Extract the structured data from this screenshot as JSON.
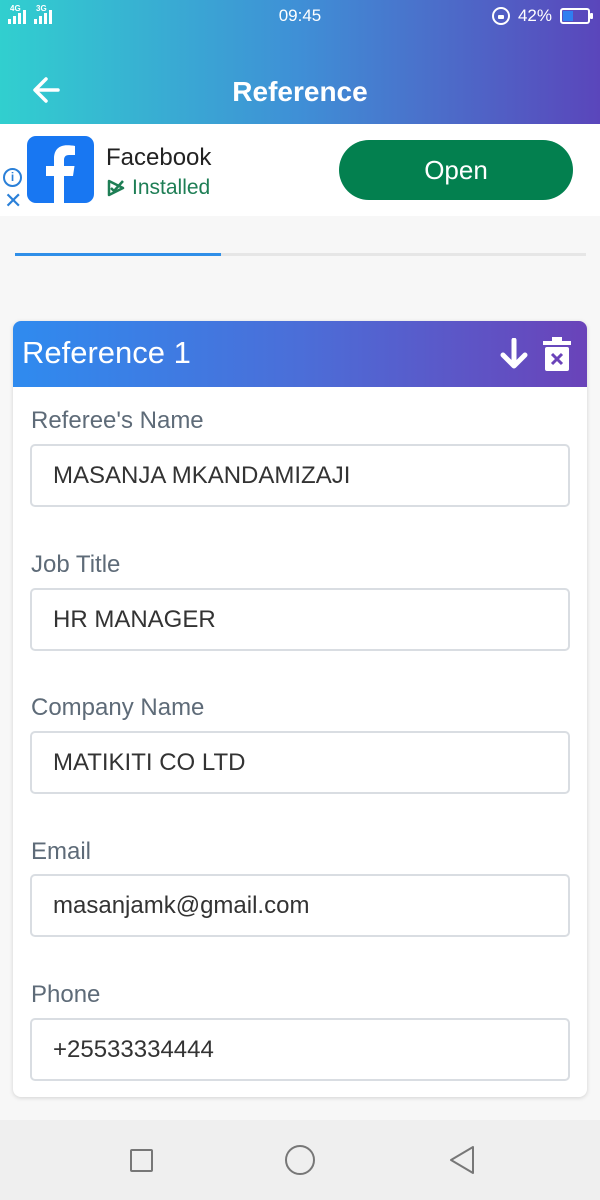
{
  "status_bar": {
    "net1": "4G",
    "net2": "3G",
    "time": "09:45",
    "battery": "42%",
    "battery_level": 0.42
  },
  "app_bar": {
    "title": "Reference"
  },
  "ad": {
    "app_name": "Facebook",
    "status": "Installed",
    "button_label": "Open"
  },
  "progress": {
    "fraction": 0.36
  },
  "reference": {
    "title": "Reference 1",
    "fields": [
      {
        "label": "Referee's Name",
        "value": "MASANJA MKANDAMIZAJI"
      },
      {
        "label": "Job Title",
        "value": "HR MANAGER"
      },
      {
        "label": "Company Name",
        "value": "MATIKITI CO LTD"
      },
      {
        "label": "Email",
        "value": "masanjamk@gmail.com"
      },
      {
        "label": "Phone",
        "value": "+25533334444"
      }
    ]
  },
  "colors": {
    "accent": "#2f8fe8",
    "open_button": "#03804f",
    "header_start": "#31cfcf",
    "header_end": "#5a46bb"
  }
}
